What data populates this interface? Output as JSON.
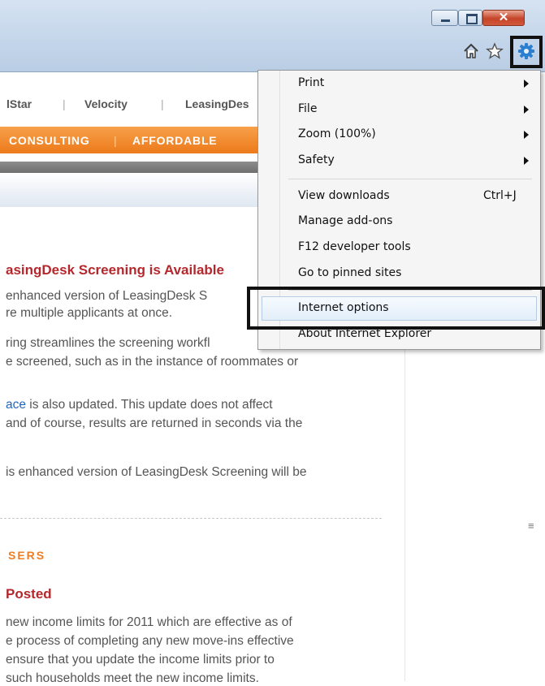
{
  "window": {
    "controls": {
      "minimize_icon": "minimize-icon",
      "maximize_icon": "maximize-icon",
      "close_glyph": "✕"
    },
    "toolbar_icons": [
      "home-icon",
      "favorites-star-icon",
      "tools-gear-icon"
    ],
    "accent": "#ec7a1a"
  },
  "page": {
    "top_nav": [
      "lStar",
      "Velocity",
      "LeasingDes"
    ],
    "orange_nav": [
      "CONSULTING",
      "AFFORDABLE"
    ],
    "article": {
      "heading": "asingDesk Screening is Available",
      "lines": [
        "enhanced version of LeasingDesk S",
        "re multiple applicants at once.",
        "ring streamlines the screening workfl",
        "e screened, such as in the instance of roommates or"
      ],
      "p2_link": "ace",
      "p2_line1_rest": " is also updated. This update does not affect",
      "p2_line2": "and of course, results are returned in seconds via the",
      "p3_line1": "is enhanced version of LeasingDesk Screening will be"
    },
    "section_label": "SERS",
    "posted": {
      "heading": "Posted",
      "lines": [
        "new income limits for 2011 which are effective as of",
        "e process of completing any new move-ins effective",
        "ensure that you update the income limits prior to",
        "such households meet the new income limits."
      ]
    }
  },
  "menu": {
    "items": [
      {
        "label": "Print",
        "submenu": true
      },
      {
        "label": "File",
        "submenu": true
      },
      {
        "label": "Zoom (100%)",
        "submenu": true
      },
      {
        "label": "Safety",
        "submenu": true
      },
      {
        "label": "View downloads",
        "shortcut": "Ctrl+J"
      },
      {
        "label": "Manage add-ons"
      },
      {
        "label": "F12 developer tools"
      },
      {
        "label": "Go to pinned sites"
      },
      {
        "label": "Internet options",
        "highlighted": true
      },
      {
        "label": "About Internet Explorer"
      }
    ]
  }
}
